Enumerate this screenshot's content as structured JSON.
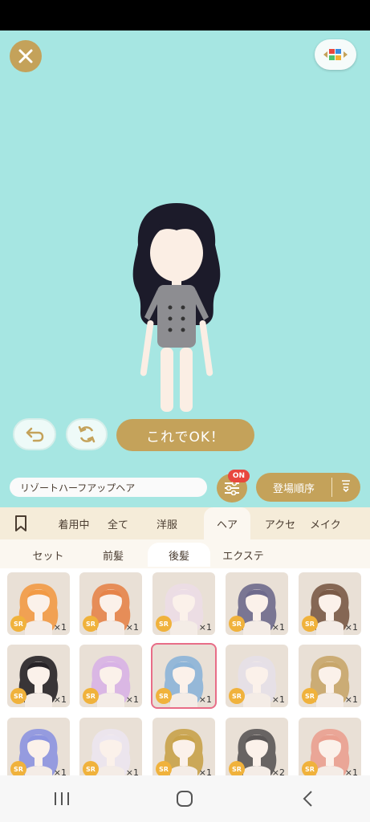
{
  "stage": {
    "ok_label": "これでOK！",
    "colors": {
      "background": "#a6e6e2",
      "accent": "#c4a25a"
    }
  },
  "item_bar": {
    "item_name": "リゾートハーフアップヘア",
    "filter_badge": "ON",
    "sort_label": "登場順序"
  },
  "category_tabs": [
    {
      "label": "",
      "icon": "bookmark-icon"
    },
    {
      "label": "着用中"
    },
    {
      "label": "全て"
    },
    {
      "label": "洋服"
    },
    {
      "label": "ヘア",
      "active": true
    },
    {
      "label": "アクセ"
    },
    {
      "label": "メイク"
    }
  ],
  "sub_tabs": [
    {
      "label": "セット"
    },
    {
      "label": "前髪"
    },
    {
      "label": "後髪",
      "active": true
    },
    {
      "label": "エクステ"
    }
  ],
  "items": [
    {
      "rarity": "SR",
      "count": "×1",
      "hair_color": "#f29a45"
    },
    {
      "rarity": "SR",
      "count": "×1",
      "hair_color": "#e6844a"
    },
    {
      "rarity": "SR",
      "count": "×1",
      "hair_color": "#ecdde6"
    },
    {
      "rarity": "SR",
      "count": "×1",
      "hair_color": "#6e6a8c"
    },
    {
      "rarity": "SR",
      "count": "×1",
      "hair_color": "#7a5a46"
    },
    {
      "rarity": "SR",
      "count": "×1",
      "hair_color": "#262226"
    },
    {
      "rarity": "SR",
      "count": "×1",
      "hair_color": "#d8b2e6"
    },
    {
      "rarity": "SR",
      "count": "×1",
      "hair_color": "#8cb4d8",
      "selected": true
    },
    {
      "rarity": "SR",
      "count": "×1",
      "hair_color": "#e6e0e8"
    },
    {
      "rarity": "SR",
      "count": "×1",
      "hair_color": "#c8a66a"
    },
    {
      "rarity": "SR",
      "count": "×1",
      "hair_color": "#8c94e0"
    },
    {
      "rarity": "SR",
      "count": "×1",
      "hair_color": "#ece6f0"
    },
    {
      "rarity": "SR",
      "count": "×1",
      "hair_color": "#c8a24a"
    },
    {
      "rarity": "SR",
      "count": "×2",
      "hair_color": "#5a5656"
    },
    {
      "rarity": "SR",
      "count": "×1",
      "hair_color": "#eaa090"
    }
  ]
}
